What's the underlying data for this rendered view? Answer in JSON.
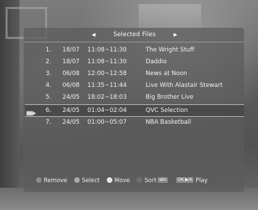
{
  "header": {
    "title": "Selected Files",
    "prev_arrow": "◀",
    "next_arrow": "▶"
  },
  "recordings": [
    {
      "number": "1.",
      "date": "18/07",
      "time": "11:08~11:30",
      "title": "The Wright Stuff"
    },
    {
      "number": "2.",
      "date": "18/07",
      "time": "11:08~11:30",
      "title": "Daddio"
    },
    {
      "number": "3.",
      "date": "06/08",
      "time": "12:00~12:58",
      "title": "News at Noon"
    },
    {
      "number": "4.",
      "date": "06/08",
      "time": "11:35~11:44",
      "title": "Live With Alastair Stewart"
    },
    {
      "number": "5.",
      "date": "24/05",
      "time": "18:02~18:03",
      "title": "Big Brother Live"
    },
    {
      "number": "6.",
      "date": "24/05",
      "time": "01:04~02:04",
      "title": "QVC Selection"
    },
    {
      "number": "7.",
      "date": "24/05",
      "time": "01:00~05:07",
      "title": "NBA Basketball"
    }
  ],
  "selected_index": 6,
  "footer": {
    "remove_label": "Remove",
    "select_label": "Select",
    "move_label": "Move",
    "sort_label": "Sort",
    "sort_key": "abc",
    "play_key": "OK ▶/II",
    "play_label": "Play"
  },
  "colors": {
    "remove_key": "#8c8c8c",
    "select_key": "#a9a9a9",
    "move_key": "#e6e6e6",
    "sort_key": "#6f6f6f",
    "selected_row_bg": "#4a4a4a"
  }
}
